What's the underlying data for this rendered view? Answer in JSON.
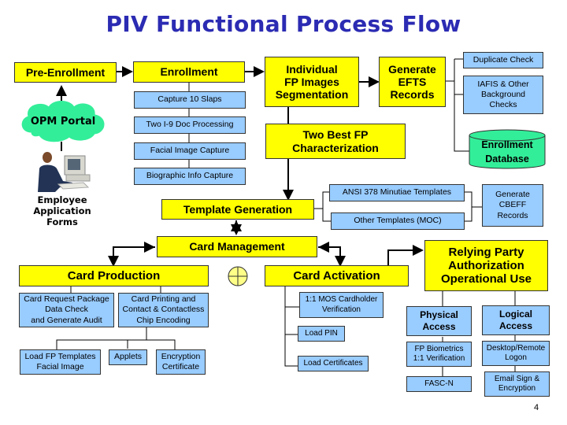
{
  "title": "PIV Functional Process Flow",
  "page_number": "4",
  "colors": {
    "title": "#2b2bb3",
    "process_box": "#ffff00",
    "sub_box": "#99ccff",
    "database": "#33ee99",
    "cloud": "#33ee99"
  },
  "enrollment_section": {
    "pre_enrollment": "Pre-Enrollment",
    "opm_portal": "OPM Portal",
    "person_icon": "person-at-computer-icon",
    "employee_forms": "Employee\nApplication\nForms",
    "enrollment": "Enrollment",
    "enrollment_steps": [
      "Capture 10 Slaps",
      "Two I-9 Doc Processing",
      "Facial Image Capture",
      "Biographic Info Capture"
    ]
  },
  "fp_processing": {
    "segmentation": "Individual\nFP Images\nSegmentation",
    "generate_efts": "Generate\nEFTS\nRecords",
    "two_best": "Two Best FP\nCharacterization",
    "checks": [
      "Duplicate Check",
      "IAFIS & Other\nBackground\nChecks"
    ],
    "database": "Enrollment\nDatabase"
  },
  "template_section": {
    "template_generation": "Template Generation",
    "templates": [
      "ANSI 378 Minutiae Templates",
      "Other Templates (MOC)"
    ],
    "cbeff": "Generate\nCBEFF\nRecords"
  },
  "card_management": {
    "label": "Card Management",
    "junction_icon": "circle-cross-icon",
    "card_production": {
      "label": "Card Production",
      "items": [
        "Card Request Package\nData Check\nand Generate Audit",
        "Card Printing and\nContact & Contactless\nChip Encoding"
      ],
      "sub_items": [
        "Load FP Templates\nFacial Image",
        "Applets",
        "Encryption\nCertificate"
      ]
    },
    "card_activation": {
      "label": "Card Activation",
      "items": [
        "1:1 MOS Cardholder\nVerification",
        "Load PIN",
        "Load Certificates"
      ]
    }
  },
  "relying_party": {
    "label": "Relying Party\nAuthorization\nOperational Use",
    "physical": {
      "label": "Physical\nAccess",
      "items": [
        "FP Biometrics\n1:1 Verification",
        "FASC-N"
      ]
    },
    "logical": {
      "label": "Logical\nAccess",
      "items": [
        "Desktop/Remote\nLogon",
        "Email Sign &\nEncryption"
      ]
    }
  }
}
